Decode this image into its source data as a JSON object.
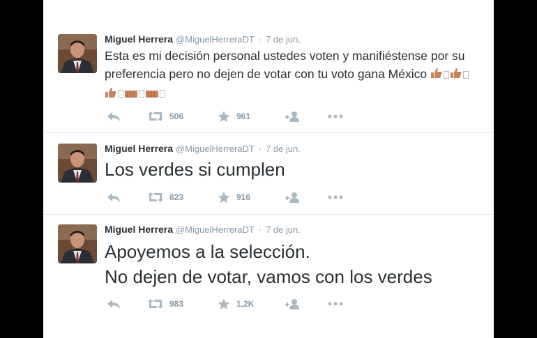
{
  "tweets": [
    {
      "name": "Miguel Herrera",
      "handle": "@MiguelHerreraDT",
      "separator": "·",
      "date": "7 de jun.",
      "text_lines": [
        "Esta es mi decisión personal ustedes voten y manifiéstense por su",
        "preferencia pero no dejen de votar con tu voto gana México"
      ],
      "retweets": "506",
      "favorites": "961"
    },
    {
      "name": "Miguel Herrera",
      "handle": "@MiguelHerreraDT",
      "separator": "·",
      "date": "7 de jun.",
      "text_lines": [
        "Los verdes si cumplen"
      ],
      "retweets": "823",
      "favorites": "916"
    },
    {
      "name": "Miguel Herrera",
      "handle": "@MiguelHerreraDT",
      "separator": "·",
      "date": "7 de jun.",
      "text_lines": [
        "Apoyemos a la selección.",
        "No dejen de votar, vamos con los verdes"
      ],
      "retweets": "983",
      "favorites": "1,2K"
    }
  ],
  "icons": {
    "reply": "reply-icon",
    "retweet": "retweet-icon",
    "favorite": "star-icon",
    "follow": "follow-icon",
    "more": "more-icon",
    "emoji": "thumbs-up-icon"
  },
  "colors": {
    "name": "#292f33",
    "meta": "#8899a6",
    "icon": "#aab8c2",
    "divider": "#e1e8ed",
    "emoji": "#c9825c"
  }
}
